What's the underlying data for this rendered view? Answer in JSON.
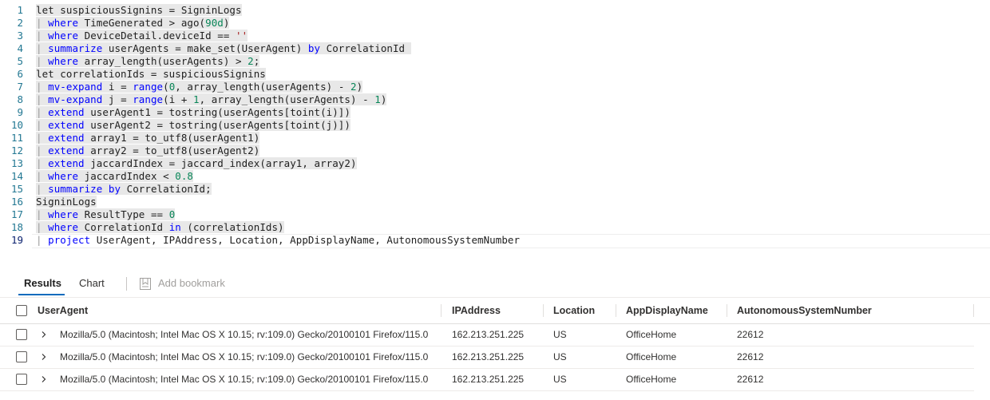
{
  "editor": {
    "lines": [
      {
        "n": "1",
        "tokens": [
          {
            "t": "let suspiciousSignins = SigninLogs",
            "c": ""
          }
        ]
      },
      {
        "n": "2",
        "tokens": [
          {
            "t": "| ",
            "c": "pipe"
          },
          {
            "t": "where",
            "c": "kw"
          },
          {
            "t": " TimeGenerated > ago(",
            "c": ""
          },
          {
            "t": "90d",
            "c": "num"
          },
          {
            "t": ")",
            "c": ""
          }
        ]
      },
      {
        "n": "3",
        "tokens": [
          {
            "t": "| ",
            "c": "pipe"
          },
          {
            "t": "where",
            "c": "kw"
          },
          {
            "t": " DeviceDetail.deviceId == ",
            "c": ""
          },
          {
            "t": "''",
            "c": "str"
          }
        ]
      },
      {
        "n": "4",
        "tokens": [
          {
            "t": "| ",
            "c": "pipe"
          },
          {
            "t": "summarize",
            "c": "kw"
          },
          {
            "t": " userAgents = make_set(UserAgent) ",
            "c": ""
          },
          {
            "t": "by",
            "c": "kw"
          },
          {
            "t": " CorrelationId ",
            "c": ""
          }
        ]
      },
      {
        "n": "5",
        "tokens": [
          {
            "t": "| ",
            "c": "pipe"
          },
          {
            "t": "where",
            "c": "kw"
          },
          {
            "t": " array_length(userAgents) > ",
            "c": ""
          },
          {
            "t": "2",
            "c": "num"
          },
          {
            "t": ";",
            "c": ""
          }
        ]
      },
      {
        "n": "6",
        "tokens": [
          {
            "t": "let correlationIds = suspiciousSignins",
            "c": ""
          }
        ]
      },
      {
        "n": "7",
        "tokens": [
          {
            "t": "| ",
            "c": "pipe"
          },
          {
            "t": "mv-expand",
            "c": "kw"
          },
          {
            "t": " i = ",
            "c": ""
          },
          {
            "t": "range",
            "c": "kw"
          },
          {
            "t": "(",
            "c": ""
          },
          {
            "t": "0",
            "c": "num"
          },
          {
            "t": ", array_length(userAgents) - ",
            "c": ""
          },
          {
            "t": "2",
            "c": "num"
          },
          {
            "t": ")",
            "c": ""
          }
        ]
      },
      {
        "n": "8",
        "tokens": [
          {
            "t": "| ",
            "c": "pipe"
          },
          {
            "t": "mv-expand",
            "c": "kw"
          },
          {
            "t": " j = ",
            "c": ""
          },
          {
            "t": "range",
            "c": "kw"
          },
          {
            "t": "(i + ",
            "c": ""
          },
          {
            "t": "1",
            "c": "num"
          },
          {
            "t": ", array_length(userAgents) - ",
            "c": ""
          },
          {
            "t": "1",
            "c": "num"
          },
          {
            "t": ")",
            "c": ""
          }
        ]
      },
      {
        "n": "9",
        "tokens": [
          {
            "t": "| ",
            "c": "pipe"
          },
          {
            "t": "extend",
            "c": "kw"
          },
          {
            "t": " userAgent1 = tostring(userAgents[toint(i)])",
            "c": ""
          }
        ]
      },
      {
        "n": "10",
        "tokens": [
          {
            "t": "| ",
            "c": "pipe"
          },
          {
            "t": "extend",
            "c": "kw"
          },
          {
            "t": " userAgent2 = tostring(userAgents[toint(j)])",
            "c": ""
          }
        ]
      },
      {
        "n": "11",
        "tokens": [
          {
            "t": "| ",
            "c": "pipe"
          },
          {
            "t": "extend",
            "c": "kw"
          },
          {
            "t": " array1 = to_utf8(userAgent1)",
            "c": ""
          }
        ]
      },
      {
        "n": "12",
        "tokens": [
          {
            "t": "| ",
            "c": "pipe"
          },
          {
            "t": "extend",
            "c": "kw"
          },
          {
            "t": " array2 = to_utf8(userAgent2)",
            "c": ""
          }
        ]
      },
      {
        "n": "13",
        "tokens": [
          {
            "t": "| ",
            "c": "pipe"
          },
          {
            "t": "extend",
            "c": "kw"
          },
          {
            "t": " jaccardIndex = jaccard_index(array1, array2)",
            "c": ""
          }
        ]
      },
      {
        "n": "14",
        "tokens": [
          {
            "t": "| ",
            "c": "pipe"
          },
          {
            "t": "where",
            "c": "kw"
          },
          {
            "t": " jaccardIndex < ",
            "c": ""
          },
          {
            "t": "0.8",
            "c": "num"
          }
        ]
      },
      {
        "n": "15",
        "tokens": [
          {
            "t": "| ",
            "c": "pipe"
          },
          {
            "t": "summarize",
            "c": "kw"
          },
          {
            "t": " ",
            "c": ""
          },
          {
            "t": "by",
            "c": "kw"
          },
          {
            "t": " CorrelationId;",
            "c": ""
          }
        ]
      },
      {
        "n": "16",
        "tokens": [
          {
            "t": "SigninLogs",
            "c": ""
          }
        ]
      },
      {
        "n": "17",
        "tokens": [
          {
            "t": "| ",
            "c": "pipe"
          },
          {
            "t": "where",
            "c": "kw"
          },
          {
            "t": " ResultType == ",
            "c": ""
          },
          {
            "t": "0",
            "c": "num"
          }
        ]
      },
      {
        "n": "18",
        "tokens": [
          {
            "t": "| ",
            "c": "pipe"
          },
          {
            "t": "where",
            "c": "kw"
          },
          {
            "t": " CorrelationId ",
            "c": ""
          },
          {
            "t": "in",
            "c": "kw"
          },
          {
            "t": " (correlationIds)",
            "c": ""
          }
        ]
      },
      {
        "n": "19",
        "tokens": [
          {
            "t": "| ",
            "c": "pipe"
          },
          {
            "t": "project",
            "c": "kw"
          },
          {
            "t": " UserAgent, IPAddress, Location, AppDisplayName, AutonomousSystemNumber",
            "c": ""
          }
        ]
      }
    ]
  },
  "results": {
    "tabs": {
      "results": "Results",
      "chart": "Chart"
    },
    "add_bookmark": "Add bookmark",
    "columns": {
      "user_agent": "UserAgent",
      "ip_address": "IPAddress",
      "location": "Location",
      "app_display_name": "AppDisplayName",
      "asn": "AutonomousSystemNumber"
    },
    "rows": [
      {
        "user_agent": "Mozilla/5.0 (Macintosh; Intel Mac OS X 10.15; rv:109.0) Gecko/20100101 Firefox/115.0",
        "ip": "162.213.251.225",
        "location": "US",
        "app": "OfficeHome",
        "asn": "22612"
      },
      {
        "user_agent": "Mozilla/5.0 (Macintosh; Intel Mac OS X 10.15; rv:109.0) Gecko/20100101 Firefox/115.0",
        "ip": "162.213.251.225",
        "location": "US",
        "app": "OfficeHome",
        "asn": "22612"
      },
      {
        "user_agent": "Mozilla/5.0 (Macintosh; Intel Mac OS X 10.15; rv:109.0) Gecko/20100101 Firefox/115.0",
        "ip": "162.213.251.225",
        "location": "US",
        "app": "OfficeHome",
        "asn": "22612"
      }
    ]
  },
  "colors": {
    "keyword": "#0000ff",
    "number": "#098658",
    "string": "#a31515",
    "accent": "#0f6cbd"
  }
}
